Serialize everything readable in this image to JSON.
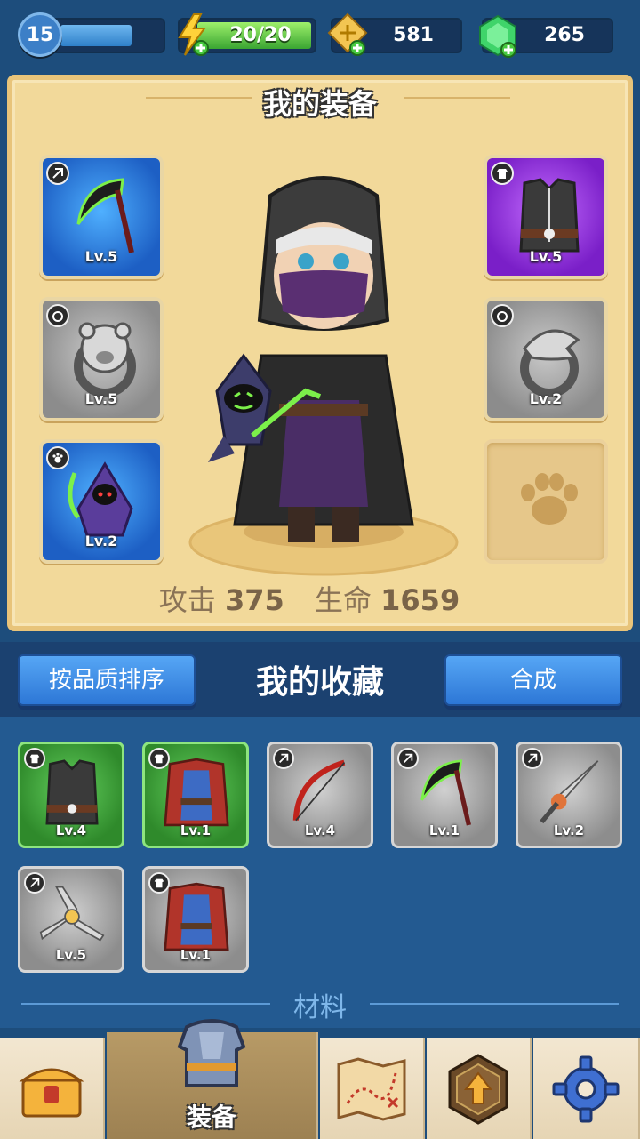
{
  "player": {
    "level": "15",
    "energy": "20/20",
    "coupons": "581",
    "gems": "265"
  },
  "equipment": {
    "title": "我的装备",
    "slots": [
      {
        "type": "weapon",
        "rarity": "blue",
        "level": "Lv.5",
        "icon": "scythe-icon"
      },
      {
        "type": "armor",
        "rarity": "purple",
        "level": "Lv.5",
        "icon": "armor-vest-icon"
      },
      {
        "type": "ring",
        "rarity": "gray",
        "level": "Lv.5",
        "icon": "bear-ring-icon"
      },
      {
        "type": "ring",
        "rarity": "gray",
        "level": "Lv.2",
        "icon": "eagle-ring-icon"
      },
      {
        "type": "pet",
        "rarity": "blue",
        "level": "Lv.2",
        "icon": "reaper-pet-icon"
      },
      {
        "type": "pet",
        "rarity": "empty",
        "level": "",
        "icon": "paw-icon"
      }
    ],
    "stats": {
      "attack_label": "攻击",
      "attack_value": "375",
      "hp_label": "生命",
      "hp_value": "1659"
    }
  },
  "collection": {
    "sort_label": "按品质排序",
    "title": "我的收藏",
    "merge_label": "合成",
    "items": [
      {
        "rarity": "green",
        "level": "Lv.4",
        "icon": "armor-vest-icon"
      },
      {
        "rarity": "green",
        "level": "Lv.1",
        "icon": "cape-armor-icon"
      },
      {
        "rarity": "gray",
        "level": "Lv.4",
        "icon": "bow-icon"
      },
      {
        "rarity": "gray",
        "level": "Lv.1",
        "icon": "scythe-icon"
      },
      {
        "rarity": "gray",
        "level": "Lv.2",
        "icon": "sword-icon"
      },
      {
        "rarity": "gray",
        "level": "Lv.5",
        "icon": "shuriken-icon"
      },
      {
        "rarity": "gray",
        "level": "Lv.1",
        "icon": "cape-armor-icon"
      }
    ],
    "materials_label": "材料"
  },
  "nav": {
    "tabs": [
      {
        "icon": "treasure-chest-icon",
        "label": ""
      },
      {
        "icon": "armor-icon",
        "label": "装备",
        "active": true
      },
      {
        "icon": "map-icon",
        "label": ""
      },
      {
        "icon": "upgrade-arrow-icon",
        "label": ""
      },
      {
        "icon": "gear-icon",
        "label": ""
      }
    ]
  },
  "colors": {
    "panel": "#f2d99a",
    "background": "#1d4d7c",
    "button": "#3a8be5"
  }
}
